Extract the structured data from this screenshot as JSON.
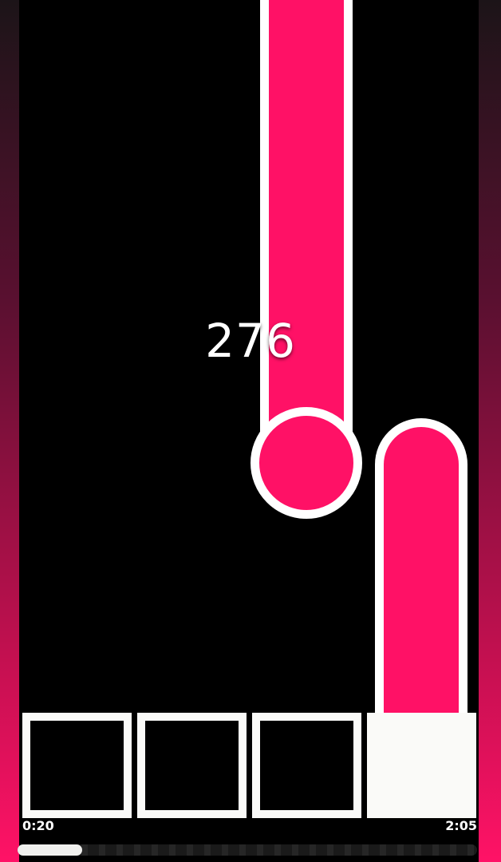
{
  "score": "276",
  "time_elapsed": "0:20",
  "time_total": "2:05",
  "progress": 0.14,
  "colors": {
    "tile": "#ff1166",
    "accent": "#ffffff"
  },
  "keys": [
    {
      "pressed": false
    },
    {
      "pressed": false
    },
    {
      "pressed": false
    },
    {
      "pressed": true
    }
  ]
}
